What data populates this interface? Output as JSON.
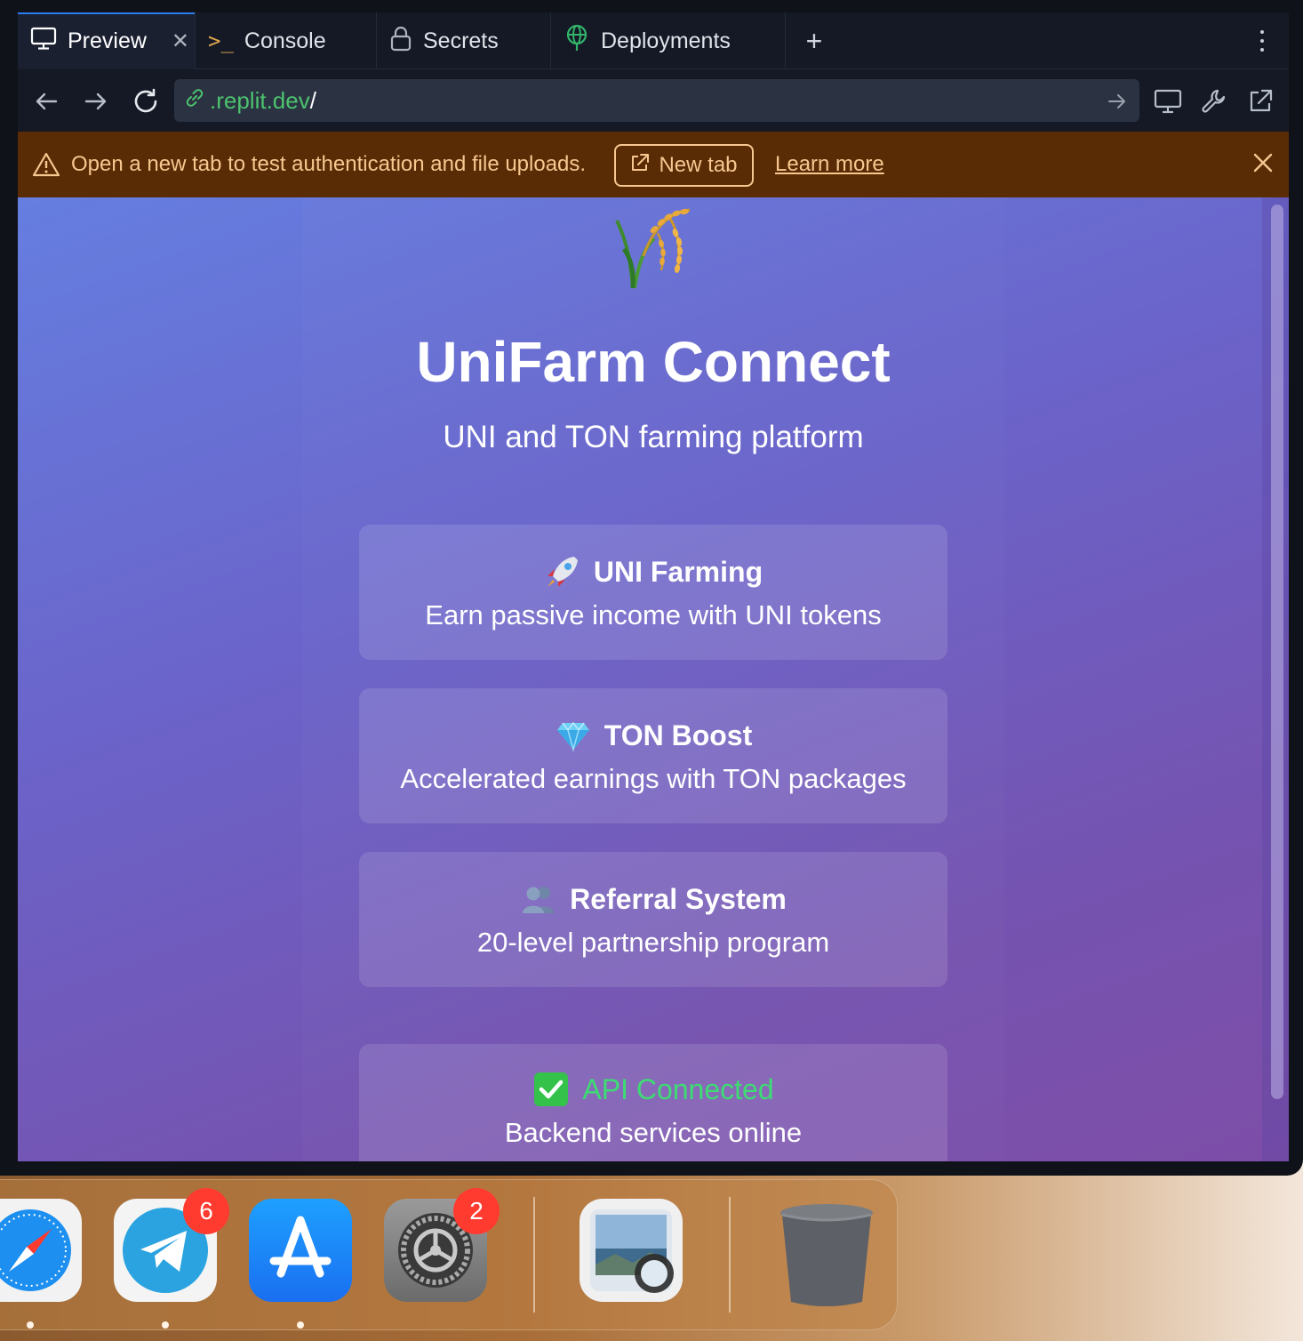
{
  "tabs": {
    "preview": "Preview",
    "console": "Console",
    "secrets": "Secrets",
    "deployments": "Deployments"
  },
  "url": {
    "domain": ".replit.dev",
    "path": "/"
  },
  "banner": {
    "message": "Open a new tab to test authentication and file uploads.",
    "new_tab": "New tab",
    "learn_more": "Learn more"
  },
  "app": {
    "title": "UniFarm Connect",
    "subtitle": "UNI and TON farming platform",
    "cards": [
      {
        "title": "UNI Farming",
        "desc": "Earn passive income with UNI tokens"
      },
      {
        "title": "TON Boost",
        "desc": "Accelerated earnings with TON packages"
      },
      {
        "title": "Referral System",
        "desc": "20-level partnership program"
      }
    ],
    "status": {
      "title": "API Connected",
      "desc": "Backend services online"
    }
  },
  "dock": {
    "telegram_badge": "6",
    "settings_badge": "2"
  },
  "colors": {
    "accent_tab": "#2b7cf2",
    "url_domain": "#4cc36e",
    "banner_bg": "#5a2c05",
    "banner_text": "#f6c790",
    "status_green": "#3ddc73"
  }
}
